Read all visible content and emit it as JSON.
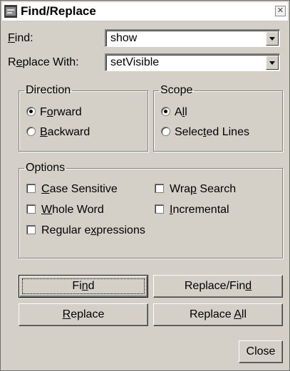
{
  "window": {
    "title": "Find/Replace",
    "close_glyph": "✕",
    "icon": "app-icon"
  },
  "find": {
    "label": "Find:",
    "value": "show"
  },
  "replace": {
    "label": "Replace With:",
    "value": "setVisible"
  },
  "direction": {
    "title": "Direction",
    "forward": {
      "label": "Forward",
      "checked": true
    },
    "backward": {
      "label": "Backward",
      "checked": false
    }
  },
  "scope": {
    "title": "Scope",
    "all": {
      "label": "All",
      "checked": true
    },
    "selected": {
      "label": "Selected Lines",
      "checked": false
    }
  },
  "options": {
    "title": "Options",
    "case_sensitive": {
      "label": "Case Sensitive",
      "checked": false
    },
    "wrap_search": {
      "label": "Wrap Search",
      "checked": false
    },
    "whole_word": {
      "label": "Whole Word",
      "checked": false
    },
    "incremental": {
      "label": "Incremental",
      "checked": false
    },
    "regex": {
      "label": "Regular expressions",
      "checked": false
    }
  },
  "buttons": {
    "find": "Find",
    "replace_find": "Replace/Find",
    "replace": "Replace",
    "replace_all": "Replace All",
    "close": "Close"
  }
}
